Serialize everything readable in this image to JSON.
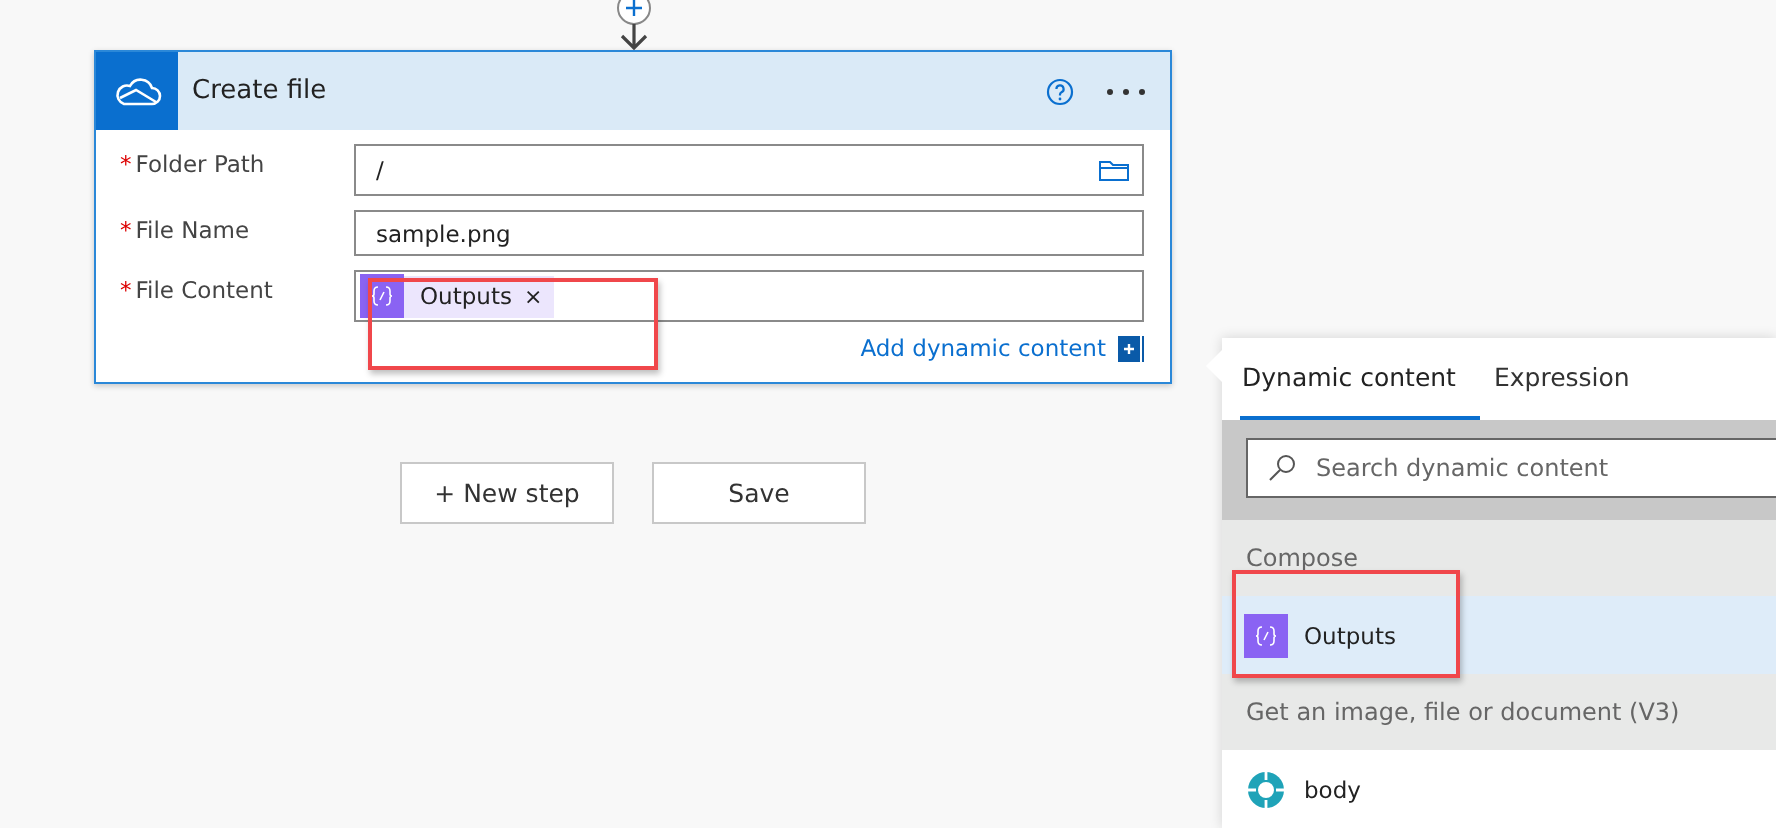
{
  "action": {
    "title": "Create file",
    "fields": [
      {
        "label": "Folder Path",
        "required_mark": "*",
        "kind": "text",
        "value": "/",
        "browse": true
      },
      {
        "label": "File Name",
        "required_mark": "*",
        "kind": "text",
        "value": "sample.png",
        "browse": false
      },
      {
        "label": "File Content",
        "required_mark": "*",
        "kind": "tokens",
        "tokens": [
          {
            "label": "Outputs",
            "remove": "×"
          }
        ]
      }
    ],
    "add_dynamic_link": "Add dynamic content"
  },
  "buttons": [
    "+ New step",
    "Save"
  ],
  "dynamic_panel": {
    "tabs": [
      {
        "label": "Dynamic content",
        "selected": true
      },
      {
        "label": "Expression",
        "selected": false
      }
    ],
    "search": {
      "placeholder": "Search dynamic content"
    },
    "groups": [
      {
        "title": "Compose",
        "items": [
          {
            "label": "Outputs",
            "selected": true,
            "kind": "expression"
          }
        ]
      },
      {
        "title": "Get an image, file or document (V3)",
        "items": [
          {
            "label": "body",
            "selected": false,
            "kind": "connector"
          }
        ]
      }
    ]
  }
}
